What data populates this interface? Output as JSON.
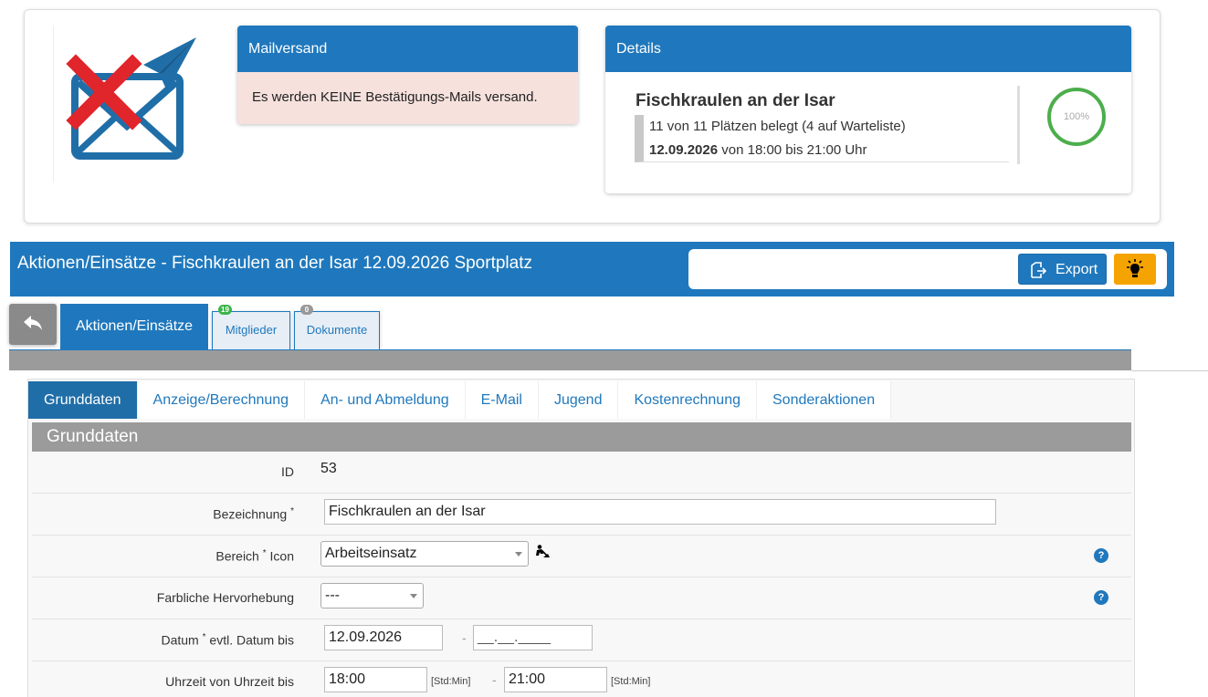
{
  "mail": {
    "title": "Mailversand",
    "message": "Es werden KEINE Bestätigungs-Mails versand."
  },
  "details": {
    "header": "Details",
    "event_title": "Fischkraulen an der Isar",
    "occupancy": "11 von 11 Plätzen belegt (4 auf Warteliste)",
    "date": "12.09.2026",
    "time_text": " von 18:00 bis 21:00 Uhr",
    "percent": "100%"
  },
  "page_title": "Aktionen/Einsätze - Fischkraulen an der Isar 12.09.2026 Sportplatz",
  "toolbar": {
    "export_label": "Export"
  },
  "tabs": {
    "main": "Aktionen/Einsätze",
    "members": {
      "label": "Mitglieder",
      "count": "19"
    },
    "documents": {
      "label": "Dokumente",
      "count": "0"
    }
  },
  "subtabs": [
    "Grunddaten",
    "Anzeige/Berechnung",
    "An- und Abmeldung",
    "E-Mail",
    "Jugend",
    "Kostenrechnung",
    "Sonderaktionen"
  ],
  "section_title": "Grunddaten",
  "form": {
    "id_label": "ID",
    "id_value": "53",
    "name_label": "Bezeichnung",
    "name_value": "Fischkraulen an der Isar",
    "area_label": "Bereich",
    "icon_label": "Icon",
    "area_value": "Arbeitseinsatz",
    "color_label": "Farbliche Hervorhebung",
    "color_value": "---",
    "date_label": "Datum",
    "date_to_label": "evtl. Datum bis",
    "date_value": "12.09.2026",
    "date_to_placeholder": "__.__.____",
    "time_label": "Uhrzeit von Uhrzeit bis",
    "time_from": "18:00",
    "time_to": "21:00",
    "time_hint": "[Std:Min]",
    "dash": "-",
    "required_mark": "*",
    "help": "?"
  },
  "colors": {
    "primary": "#1f78bd",
    "warning": "#f5a300",
    "mail_bg": "#f6e1dd",
    "gauge": "#4cae4c",
    "error_x": "#e0252b"
  }
}
